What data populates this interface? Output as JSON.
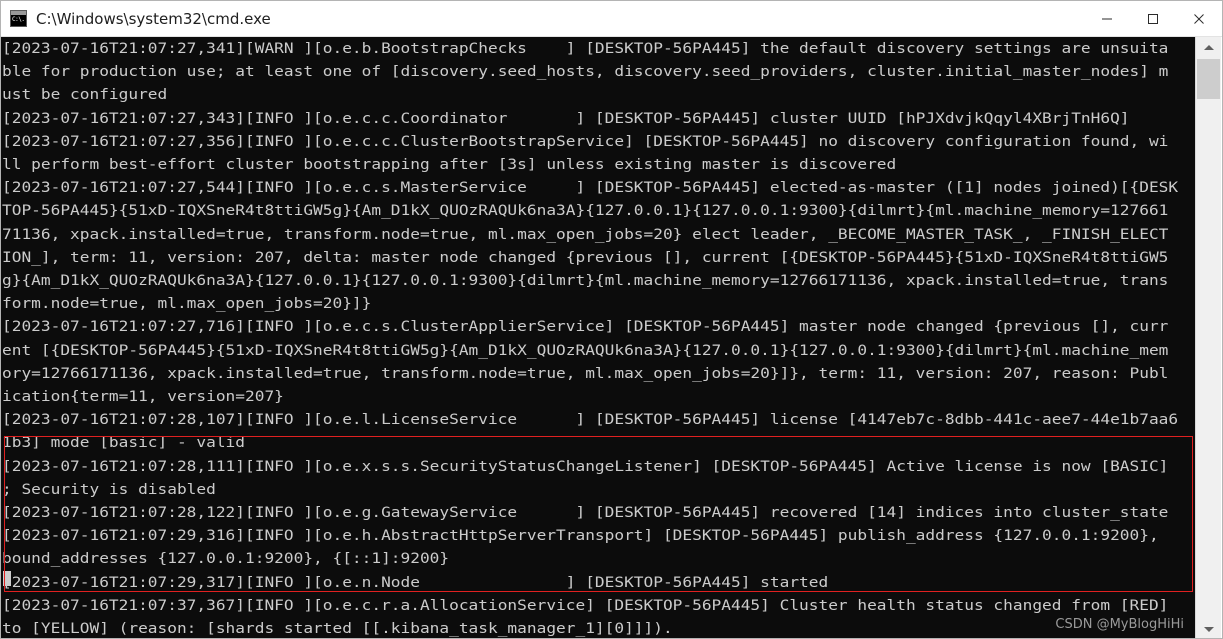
{
  "window": {
    "title": "C:\\Windows\\system32\\cmd.exe",
    "icon": "cmd-icon",
    "icon_glyph": "C:\\.",
    "background_color": "#0c0c0c",
    "text_color": "#cccccc",
    "titlebar_color": "#ffffff"
  },
  "window_controls": {
    "minimize": "minimize-icon",
    "maximize": "maximize-icon",
    "close": "close-icon"
  },
  "console": {
    "text": "[2023-07-16T21:07:27,341][WARN ][o.e.b.BootstrapChecks    ] [DESKTOP-56PA445] the default discovery settings are unsuita\nble for production use; at least one of [discovery.seed_hosts, discovery.seed_providers, cluster.initial_master_nodes] m\nust be configured\n[2023-07-16T21:07:27,343][INFO ][o.e.c.c.Coordinator       ] [DESKTOP-56PA445] cluster UUID [hPJXdvjkQqyl4XBrjTnH6Q]\n[2023-07-16T21:07:27,356][INFO ][o.e.c.c.ClusterBootstrapService] [DESKTOP-56PA445] no discovery configuration found, wi\nll perform best-effort cluster bootstrapping after [3s] unless existing master is discovered\n[2023-07-16T21:07:27,544][INFO ][o.e.c.s.MasterService     ] [DESKTOP-56PA445] elected-as-master ([1] nodes joined)[{DESK\nTOP-56PA445}{51xD-IQXSneR4t8ttiGW5g}{Am_D1kX_QUOzRAQUk6na3A}{127.0.0.1}{127.0.0.1:9300}{dilmrt}{ml.machine_memory=127661\n71136, xpack.installed=true, transform.node=true, ml.max_open_jobs=20} elect leader, _BECOME_MASTER_TASK_, _FINISH_ELECT\nION_], term: 11, version: 207, delta: master node changed {previous [], current [{DESKTOP-56PA445}{51xD-IQXSneR4t8ttiGW5\ng}{Am_D1kX_QUOzRAQUk6na3A}{127.0.0.1}{127.0.0.1:9300}{dilmrt}{ml.machine_memory=12766171136, xpack.installed=true, trans\nform.node=true, ml.max_open_jobs=20}]}\n[2023-07-16T21:07:27,716][INFO ][o.e.c.s.ClusterApplierService] [DESKTOP-56PA445] master node changed {previous [], curr\nent [{DESKTOP-56PA445}{51xD-IQXSneR4t8ttiGW5g}{Am_D1kX_QUOzRAQUk6na3A}{127.0.0.1}{127.0.0.1:9300}{dilmrt}{ml.machine_mem\nory=12766171136, xpack.installed=true, transform.node=true, ml.max_open_jobs=20}]}, term: 11, version: 207, reason: Publ\nication{term=11, version=207}\n[2023-07-16T21:07:28,107][INFO ][o.e.l.LicenseService      ] [DESKTOP-56PA445] license [4147eb7c-8dbb-441c-aee7-44e1b7aa6\n1b3] mode [basic] - valid\n[2023-07-16T21:07:28,111][INFO ][o.e.x.s.s.SecurityStatusChangeListener] [DESKTOP-56PA445] Active license is now [BASIC]\n; Security is disabled\n[2023-07-16T21:07:28,122][INFO ][o.e.g.GatewayService      ] [DESKTOP-56PA445] recovered [14] indices into cluster_state\n[2023-07-16T21:07:29,316][INFO ][o.e.h.AbstractHttpServerTransport] [DESKTOP-56PA445] publish_address {127.0.0.1:9200},\nbound_addresses {127.0.0.1:9200}, {[::1]:9200}\n[2023-07-16T21:07:29,317][INFO ][o.e.n.Node               ] [DESKTOP-56PA445] started\n[2023-07-16T21:07:37,367][INFO ][o.e.c.r.a.AllocationService] [DESKTOP-56PA445] Cluster health status changed from [RED]\nto [YELLOW] (reason: [shards started [[.kibana_task_manager_1][0]]]).\n",
    "cursor_present": true
  },
  "annotation": {
    "highlight_color": "#e02020",
    "note": "red-rectangle-highlight"
  },
  "watermark": {
    "text": "CSDN @MyBlogHiHi"
  },
  "scrollbar": {
    "up_arrow": "scroll-up-icon",
    "down_arrow": "scroll-down-icon",
    "thumb": "scroll-thumb"
  }
}
